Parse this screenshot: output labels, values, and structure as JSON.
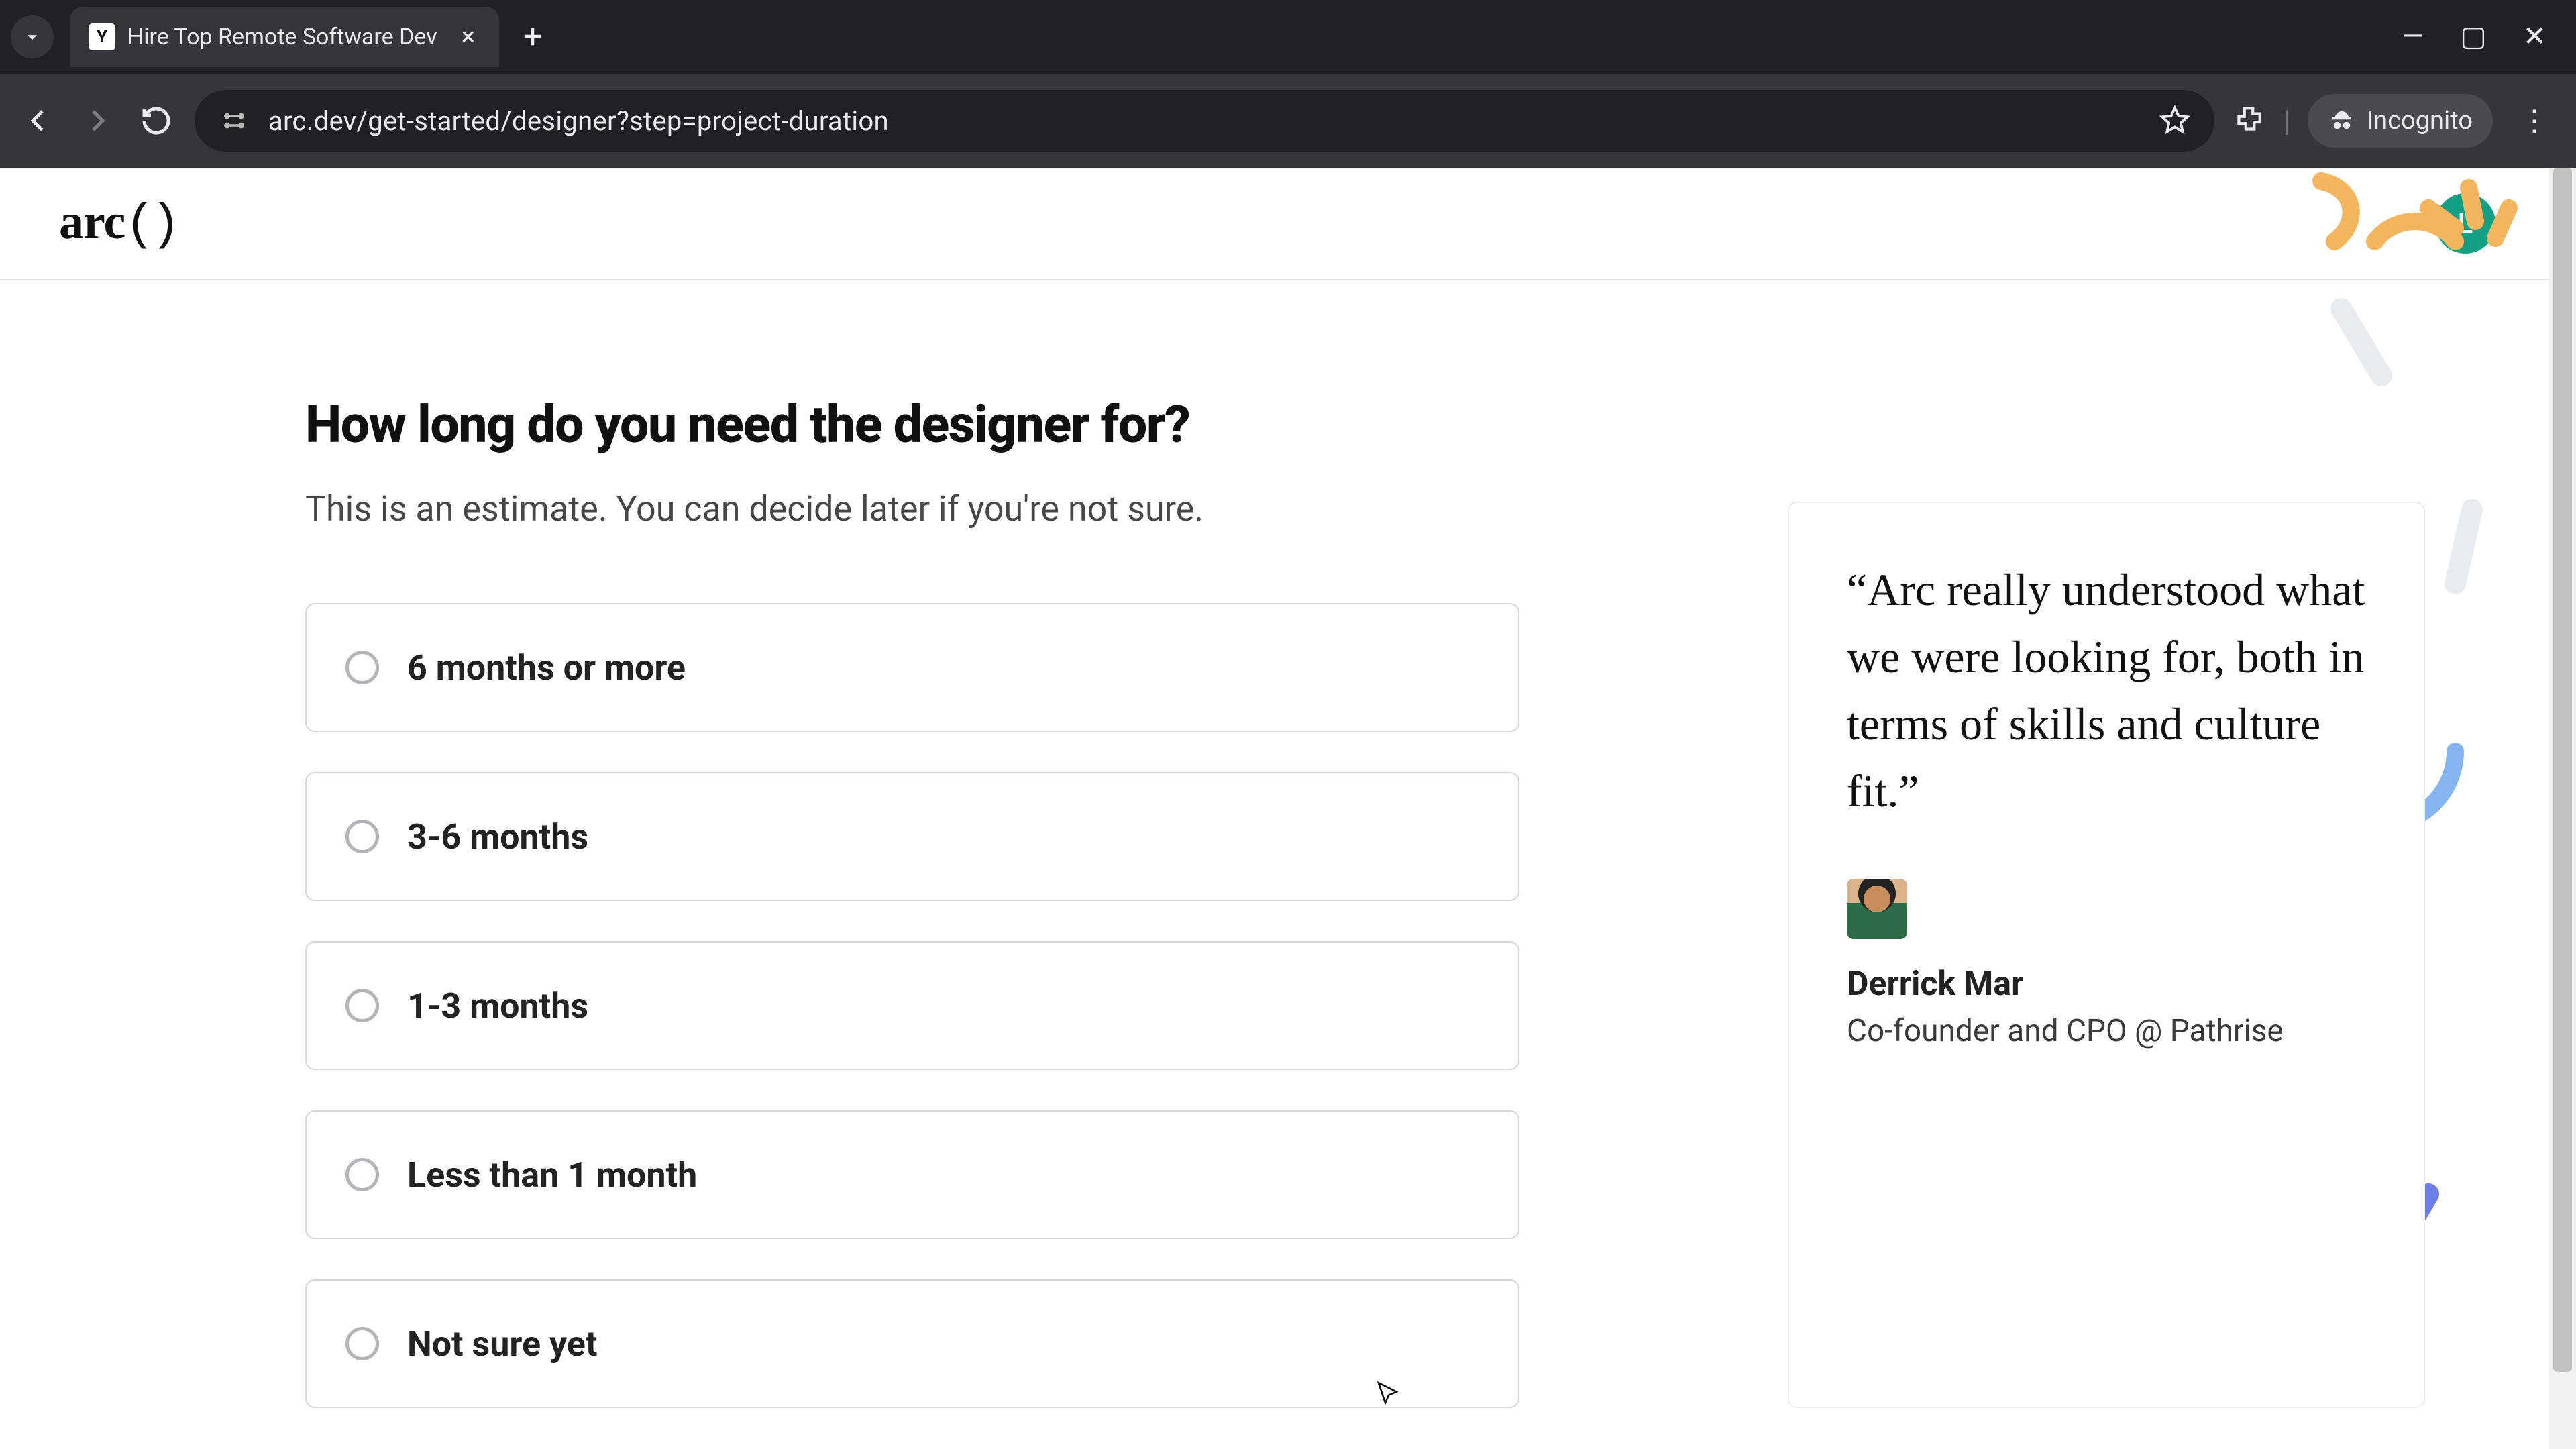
{
  "browser": {
    "tab_title": "Hire Top Remote Software Dev",
    "url": "arc.dev/get-started/designer?step=project-duration",
    "incognito_label": "Incognito"
  },
  "header": {
    "logo_text": "arc",
    "avatar_initial": "L",
    "avatar_color": "#14a085"
  },
  "question": {
    "title": "How long do you need the designer for?",
    "subtitle": "This is an estimate. You can decide later if you're not sure."
  },
  "options": [
    {
      "label": "6 months or more"
    },
    {
      "label": "3-6 months"
    },
    {
      "label": "1-3 months"
    },
    {
      "label": "Less than 1 month"
    },
    {
      "label": "Not sure yet"
    }
  ],
  "testimonial": {
    "quote": "“Arc really understood what we were looking for, both in terms of skills and culture fit.”",
    "name": "Derrick Mar",
    "role": "Co-founder and CPO @ Pathrise"
  }
}
